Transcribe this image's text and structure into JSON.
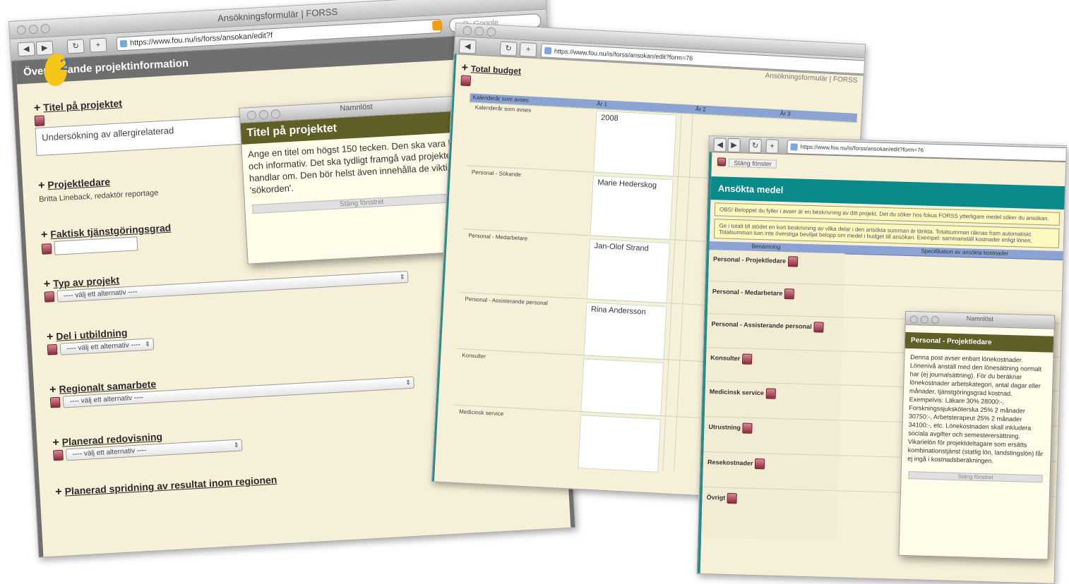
{
  "logo": {
    "text": "2",
    "color": "#f5c518"
  },
  "win1": {
    "title": "Ansökningsformulär | FORSS",
    "url": "https://www.fou.nu/is/forss/ansokan/edit?f",
    "search_placeholder": "Q- Google",
    "section_title": "Övergripande projektinformation",
    "fields": {
      "titel": {
        "label": "Titel på projektet",
        "value": "Undersökning av allergirelaterad"
      },
      "ledare": {
        "label": "Projektledare",
        "text": "Britta Lineback, redaktör reportage"
      },
      "faktisk": {
        "label": "Faktisk tjänstgöringsgrad"
      },
      "typ": {
        "label": "Typ av projekt",
        "select": "---- välj ett alternativ ----"
      },
      "del": {
        "label": "Del i utbildning",
        "select": "---- välj ett alternativ ----"
      },
      "regionalt": {
        "label": "Regionalt samarbete",
        "select": "---- välj ett alternativ ----"
      },
      "planerad": {
        "label": "Planerad redovisning",
        "select": "---- välj ett alternativ ----"
      },
      "spridning": {
        "label": "Planerad spridning av resultat inom regionen"
      }
    },
    "popup": {
      "window_title": "Namnlöst",
      "title": "Titel på projektet",
      "body": "Ange en titel om högst 150 tecken. Den ska vara kort och informativ. Det ska tydligt framgå vad projektet handlar om. Den bör helst även innehålla de viktigaste 'sökorden'.",
      "close": "Stäng fönstret"
    }
  },
  "win2": {
    "title": "Ansökningsformulär | FORSS",
    "url": "https://www.fou.nu/is/forss/ansokan/edit?form=76",
    "heading": "Total budget",
    "header_col0": "Kalenderår som avses",
    "years": [
      "År 1",
      "År 2",
      "År 3"
    ],
    "rows": [
      {
        "label": "Kalenderår som avses",
        "value": "2008"
      },
      {
        "label": "Personal - Sökande",
        "value": "Marie Hederskog"
      },
      {
        "label": "Personal - Medarbetare",
        "value": "Jan-Olof Strand"
      },
      {
        "label": "Personal - Assisterande personal",
        "value": "Rina Andersson"
      },
      {
        "label": "Konsulter",
        "value": ""
      },
      {
        "label": "Medicinsk service",
        "value": ""
      }
    ]
  },
  "win3": {
    "url": "https://www.fou.nu/is/forss/ansokan/edit?form=76",
    "close_link": "Stäng fönster",
    "heading": "Ansökta medel",
    "info1": "OBS! Beloppet du fyller i avser är en beskrivning av ditt projekt. Det du söker hos fokus FORSS ytterligare medel söker du ansökan.",
    "info2": "Ge i totalt till stödet en kort beskrivning av vilka delar i den ansökta summan är tänkta. Totalsumman räknas fram automatiskt. Totalsumman kan inte överstiga beviljat belopp om medel i budget till ansökan. Exempel: sammanställ kostnader enligt lönen.",
    "table_header": "Specifikation av ansökta kostnader",
    "table_header_left": "Benämning",
    "rows": [
      "Personal - Projektledare",
      "Personal - Medarbetare",
      "Personal - Assisterande personal",
      "Konsulter",
      "Medicinsk service",
      "Utrustning",
      "Resekostnader",
      "Övrigt"
    ],
    "popup": {
      "window_title": "Namnlöst",
      "title": "Personal - Projektledare",
      "body": "Denna post avser enbart lönekostnader. Lönenivå anställ med den lönesättning normalt har (ej journalsättning). För du beräknar lönekostnader arbetskategori, antal dagar eller månader, tjänstgöringsgrad kostnad. Exempelvis: Läkare 30% 28000:-, Forskningssjuksköterska 25% 2 månader 30750:-, Arbetsterapeut 25% 2 månader 34100:-, etc. Lönekostnaden skall inkludera sociala avgifter och semesterersättning. Vikarielön för projektdeltagare som ersätts kombinationstjänst (statlig lön, landstingslön) får ej ingå i kostnadsberäkningen.",
      "close": "Stäng fönstret"
    }
  }
}
